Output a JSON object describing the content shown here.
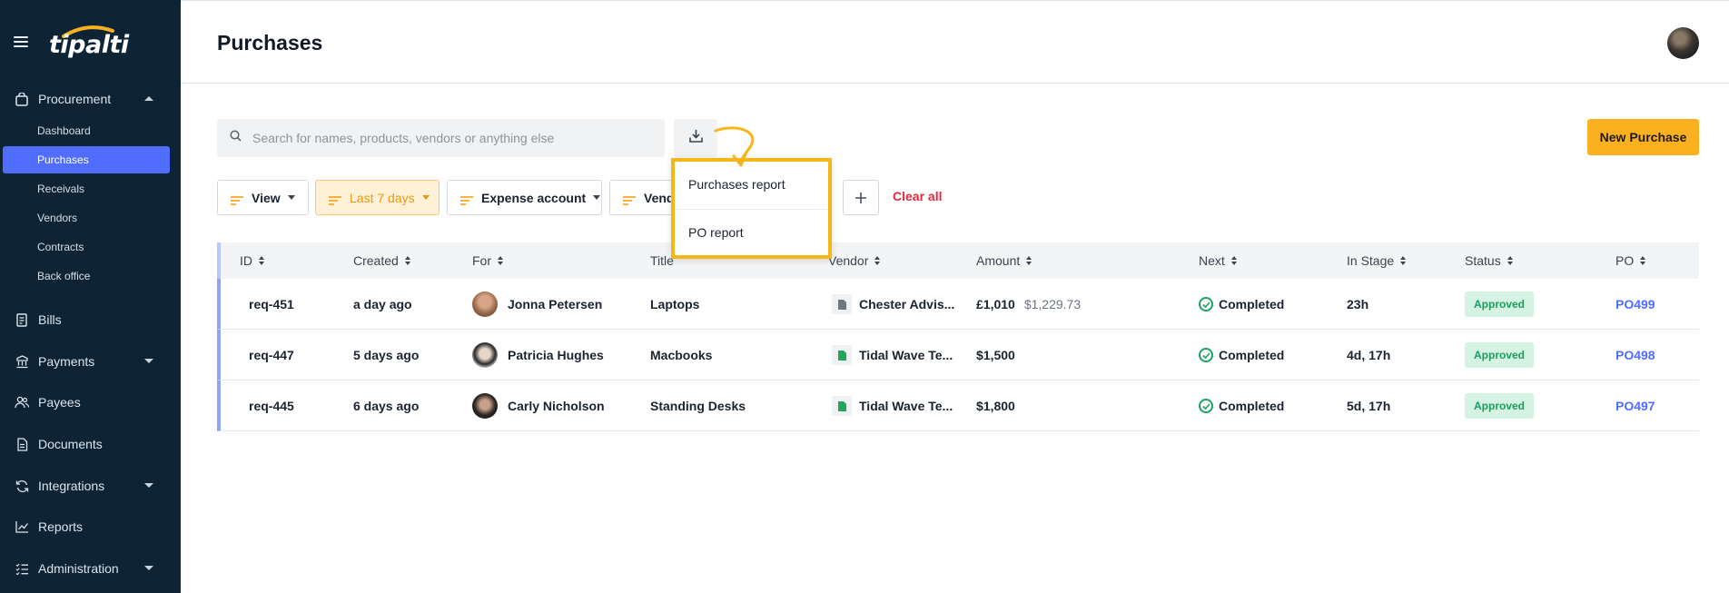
{
  "app": {
    "logo_text": "tipalti"
  },
  "sidebar": {
    "sections": [
      {
        "label": "Procurement",
        "icon": "bag-icon",
        "expanded": true
      },
      {
        "label": "Bills",
        "icon": "bill-icon"
      },
      {
        "label": "Payments",
        "icon": "payments-icon",
        "expandable": true
      },
      {
        "label": "Payees",
        "icon": "payees-icon"
      },
      {
        "label": "Documents",
        "icon": "document-icon"
      },
      {
        "label": "Integrations",
        "icon": "integrations-icon",
        "expandable": true
      },
      {
        "label": "Reports",
        "icon": "chart-icon"
      },
      {
        "label": "Administration",
        "icon": "checklist-icon",
        "expandable": true
      }
    ],
    "procurement_items": [
      "Dashboard",
      "Purchases",
      "Receivals",
      "Vendors",
      "Contracts",
      "Back office"
    ],
    "active_item": "Purchases"
  },
  "header": {
    "title": "Purchases"
  },
  "search": {
    "placeholder": "Search for names, products, vendors or anything else"
  },
  "actions": {
    "new_purchase": "New Purchase",
    "clear_all": "Clear all"
  },
  "filters": [
    {
      "label": "View"
    },
    {
      "label": "Last 7 days",
      "highlighted": true
    },
    {
      "label": "Expense account"
    },
    {
      "label": "Vend"
    }
  ],
  "download_menu": {
    "items": [
      "Purchases report",
      "PO report"
    ]
  },
  "table": {
    "columns": [
      "ID",
      "Created",
      "For",
      "Title",
      "Vendor",
      "Amount",
      "Next",
      "In Stage",
      "Status",
      "PO"
    ],
    "rows": [
      {
        "id": "req-451",
        "created": "a day ago",
        "for": "Jonna Petersen",
        "title": "Laptops",
        "vendor": "Chester Advis...",
        "amount": "£1,010",
        "amount_secondary": "$1,229.73",
        "next": "Completed",
        "in_stage": "23h",
        "status": "Approved",
        "po": "PO499"
      },
      {
        "id": "req-447",
        "created": "5 days ago",
        "for": "Patricia Hughes",
        "title": "Macbooks",
        "vendor": "Tidal Wave Te...",
        "amount": "$1,500",
        "amount_secondary": "",
        "next": "Completed",
        "in_stage": "4d, 17h",
        "status": "Approved",
        "po": "PO498"
      },
      {
        "id": "req-445",
        "created": "6 days ago",
        "for": "Carly Nicholson",
        "title": "Standing Desks",
        "vendor": "Tidal Wave Te...",
        "amount": "$1,800",
        "amount_secondary": "",
        "next": "Completed",
        "in_stage": "5d, 17h",
        "status": "Approved",
        "po": "PO497"
      }
    ]
  },
  "colors": {
    "sidebar_bg": "#0e2435",
    "accent": "#4f6dff",
    "primary_button": "#fbb11f",
    "highlight_border": "#f7b617",
    "success": "#19a463",
    "danger": "#e8263b"
  }
}
